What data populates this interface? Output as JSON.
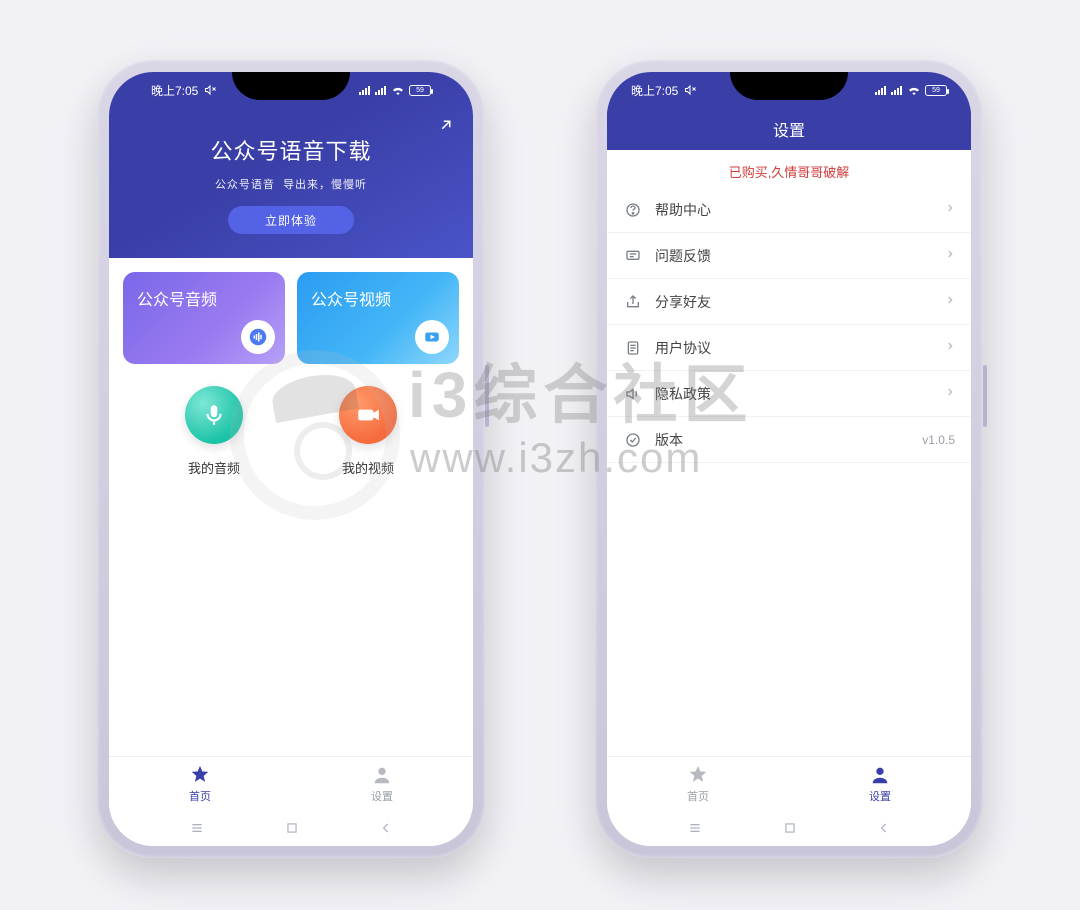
{
  "status": {
    "time": "晚上7:05"
  },
  "screen1": {
    "hero_title": "公众号语音下载",
    "hero_sub_a": "公众号语音",
    "hero_sub_b": "导出来，慢慢听",
    "cta": "立即体验",
    "card_audio": "公众号音频",
    "card_video": "公众号视频",
    "my_audio": "我的音频",
    "my_video": "我的视频"
  },
  "nav": {
    "home": "首页",
    "settings": "设置"
  },
  "screen2": {
    "title": "设置",
    "banner": "已购买,久情哥哥破解",
    "rows": {
      "help": "帮助中心",
      "feedback": "问题反馈",
      "share": "分享好友",
      "agreement": "用户协议",
      "privacy": "隐私政策",
      "version_label": "版本",
      "version_value": "v1.0.5"
    }
  },
  "watermark": {
    "brand": "i3综合社区",
    "url": "www.i3zh.com"
  }
}
